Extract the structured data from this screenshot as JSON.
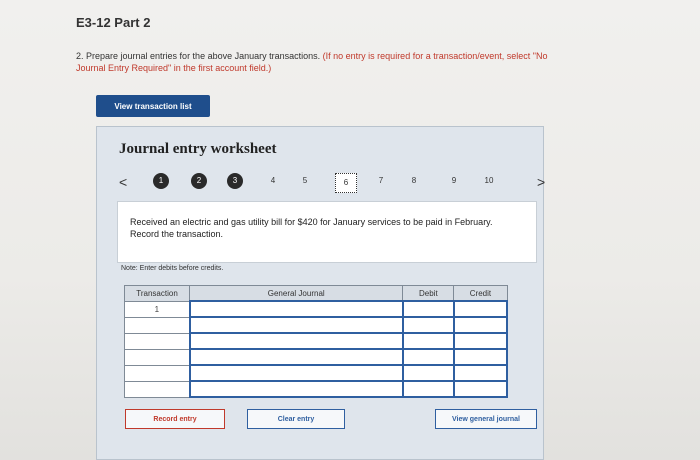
{
  "header": {
    "title": "E3-12 Part 2",
    "instruction_main": "2. Prepare journal entries for the above January transactions.",
    "instruction_note": "(If no entry is required for a transaction/event, select \"No Journal Entry Required\" in the first account field.)"
  },
  "buttons": {
    "view_transaction_list": "View transaction list",
    "record_entry": "Record entry",
    "clear_entry": "Clear entry",
    "view_general_journal": "View general journal"
  },
  "worksheet": {
    "title": "Journal entry worksheet",
    "prev_icon": "<",
    "next_icon": ">",
    "steps": [
      "1",
      "2",
      "3",
      "4",
      "5",
      "6",
      "7",
      "8",
      "9",
      "10"
    ],
    "current_step": "6",
    "description": "Received an electric and gas utility bill for $420 for January services to be paid in February. Record the transaction.",
    "note": "Note: Enter debits before credits."
  },
  "journal_table": {
    "headers": [
      "Transaction",
      "General Journal",
      "Debit",
      "Credit"
    ],
    "rows": [
      [
        "1",
        "",
        "",
        ""
      ],
      [
        "",
        "",
        "",
        ""
      ],
      [
        "",
        "",
        "",
        ""
      ],
      [
        "",
        "",
        "",
        ""
      ],
      [
        "",
        "",
        "",
        ""
      ],
      [
        "",
        "",
        "",
        ""
      ]
    ]
  },
  "colors": {
    "button_primary": "#1f4e8c",
    "panel_bg": "#dfe5ec",
    "note_red": "#c0392b",
    "link_blue": "#2f5fa0"
  }
}
